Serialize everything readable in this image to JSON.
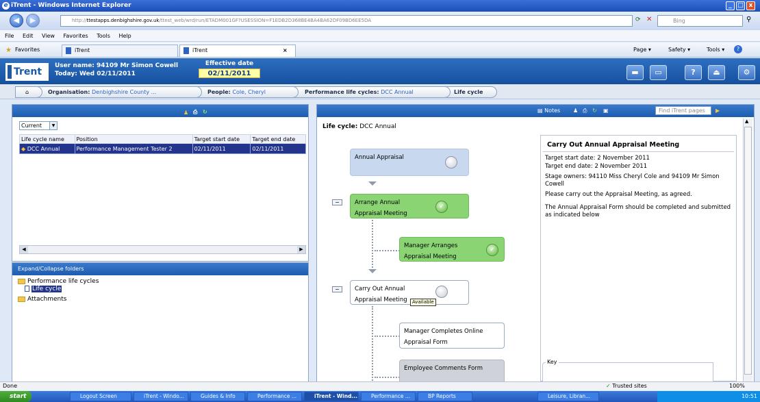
{
  "window": {
    "title": "iTrent - Windows Internet Explorer",
    "minimize": "_",
    "maximize": "□",
    "close": "x"
  },
  "browser": {
    "url": {
      "scheme": "http://",
      "host": "ttestapps.denbighshire.gov.uk",
      "path": "/ttest_web/wrd/run/ETADM001GF?USESSION=F1EDB2D368BE4BA4BA62DF09BD6EE5DA"
    },
    "search_placeholder": "Bing",
    "menu": [
      "File",
      "Edit",
      "View",
      "Favorites",
      "Tools",
      "Help"
    ],
    "favorites_label": "Favorites",
    "tabs": [
      {
        "label": "iTrent",
        "active": false
      },
      {
        "label": "iTrent",
        "active": true
      }
    ],
    "toolbar_right": [
      "Page ▾",
      "Safety ▾",
      "Tools ▾"
    ]
  },
  "app": {
    "logo": "Trent",
    "user_line": "User name: 94109 Mr Simon Cowell",
    "today_line": "Today: Wed 02/11/2011",
    "effective_label": "Effective date",
    "effective_value": "02/11/2011",
    "header_buttons": [
      "home",
      "window",
      "?",
      "person",
      "tools"
    ]
  },
  "breadcrumbs": [
    {
      "label": "Organisation:",
      "value": "Denbighshire County ..."
    },
    {
      "label": "People:",
      "value": "Cole, Cheryl"
    },
    {
      "label": "Performance life cycles:",
      "value": "DCC Annual"
    },
    {
      "label": "Life cycle",
      "value": ""
    }
  ],
  "left": {
    "filter": "Current",
    "columns": [
      "Life cycle name",
      "Position",
      "Target start date",
      "Target end date"
    ],
    "rows": [
      [
        "DCC Annual",
        "Performance Management Tester 2",
        "02/11/2011",
        "02/11/2011"
      ]
    ]
  },
  "folders": {
    "title": "Expand/Collapse folders",
    "items": [
      {
        "label": "Performance life cycles"
      },
      {
        "label": "Life cycle"
      },
      {
        "label": "Attachments"
      }
    ]
  },
  "right": {
    "notes": "Notes",
    "find_placeholder": "Find iTrent pages",
    "lifecycle_label": "Life cycle:",
    "lifecycle_value": "DCC Annual",
    "stages": [
      {
        "line1": "Annual Appraisal",
        "line2": ""
      },
      {
        "line1": "Arrange Annual",
        "line2": "Appraisal Meeting"
      },
      {
        "line1": "Manager Arranges",
        "line2": "Appraisal Meeting"
      },
      {
        "line1": "Carry Out Annual",
        "line2": "Appraisal Meeting"
      },
      {
        "line1": "Manager Completes Online",
        "line2": "Appraisal Form"
      },
      {
        "line1": "Employee Comments Form",
        "line2": ""
      }
    ],
    "tooltip": "Available",
    "detail": {
      "title": "Carry Out Annual Appraisal Meeting",
      "start": "Target start date: 2 November 2011",
      "end": "Target end date: 2 November 2011",
      "owners": "Stage owners: 94110 Miss Cheryl Cole and 94109 Mr Simon Cowell",
      "instruction": "Please carry out the Appraisal Meeting, as agreed.",
      "note": "The Annual Appraisal Form should be completed and submitted as indicated below"
    },
    "key_label": "Key"
  },
  "status": {
    "left": "Done",
    "zone": "Trusted sites",
    "zoom": "100%"
  },
  "taskbar": {
    "start": "start",
    "items": [
      {
        "label": "Logout Screen",
        "active": false
      },
      {
        "label": "iTrent - Windo...",
        "active": false
      },
      {
        "label": "Guides & Info",
        "active": false
      },
      {
        "label": "Performance ...",
        "active": false
      },
      {
        "label": "iTrent - Wind...",
        "active": true
      },
      {
        "label": "Performance ...",
        "active": false
      },
      {
        "label": "BP Reports",
        "active": false
      },
      {
        "label": "Leisure, Libran...",
        "active": false
      }
    ],
    "clock": "10:51"
  }
}
